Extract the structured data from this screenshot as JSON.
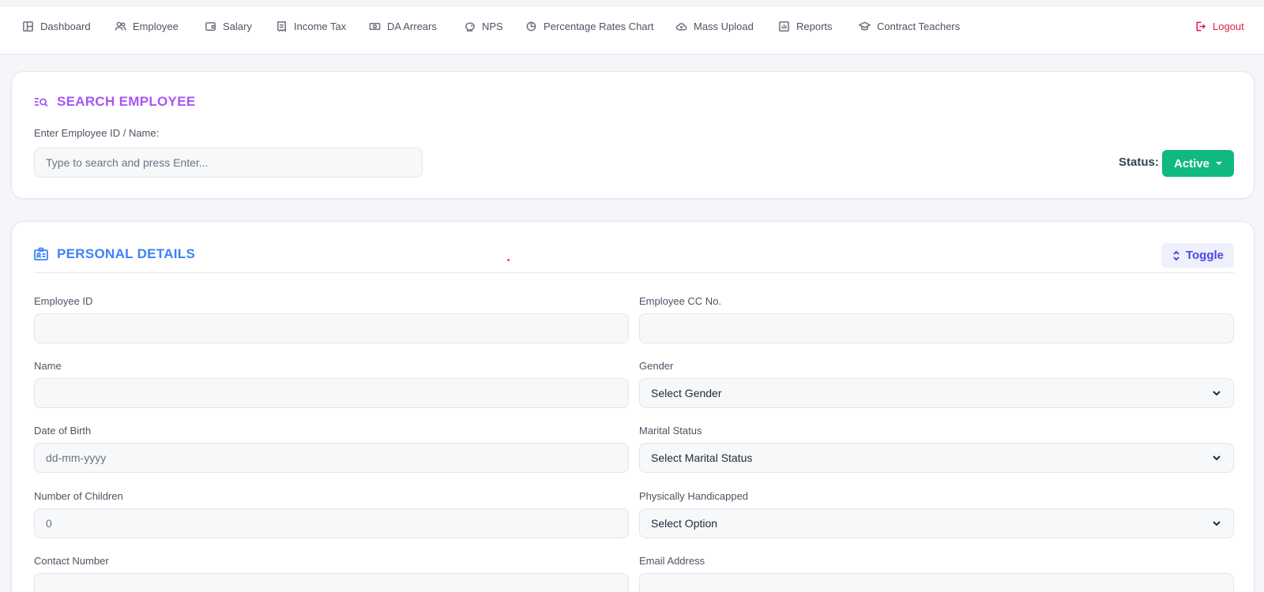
{
  "nav": {
    "items": [
      {
        "label": "Dashboard",
        "icon": "dashboard-icon"
      },
      {
        "label": "Employee",
        "icon": "users-icon"
      },
      {
        "label": "Salary",
        "icon": "wallet-icon"
      },
      {
        "label": "Income Tax",
        "icon": "receipt-icon"
      },
      {
        "label": "DA Arrears",
        "icon": "money-icon"
      },
      {
        "label": "NPS",
        "icon": "piggy-bank-icon"
      },
      {
        "label": "Percentage Rates Chart",
        "icon": "pie-chart-icon"
      },
      {
        "label": "Mass Upload",
        "icon": "cloud-upload-icon"
      },
      {
        "label": "Reports",
        "icon": "report-icon"
      },
      {
        "label": "Contract Teachers",
        "icon": "graduation-cap-icon"
      }
    ],
    "logout_label": "Logout"
  },
  "search": {
    "title": "SEARCH EMPLOYEE",
    "field_label": "Enter Employee ID / Name:",
    "placeholder": "Type to search and press Enter...",
    "status_label": "Status:",
    "status_value": "Active"
  },
  "personal": {
    "title": "PERSONAL DETAILS",
    "toggle_label": "Toggle",
    "fields": {
      "employee_id": {
        "label": "Employee ID",
        "value": ""
      },
      "employee_cc": {
        "label": "Employee CC No.",
        "value": ""
      },
      "name": {
        "label": "Name",
        "value": ""
      },
      "gender": {
        "label": "Gender",
        "value": "Select Gender"
      },
      "dob": {
        "label": "Date of Birth",
        "value": "dd-mm-yyyy"
      },
      "marital": {
        "label": "Marital Status",
        "value": "Select Marital Status"
      },
      "children": {
        "label": "Number of Children",
        "value": "0"
      },
      "handicapped": {
        "label": "Physically Handicapped",
        "value": "Select Option"
      },
      "contact": {
        "label": "Contact Number",
        "value": ""
      },
      "email": {
        "label": "Email Address",
        "value": ""
      }
    }
  },
  "colors": {
    "accent_purple": "#a855f7",
    "accent_blue": "#3b82f6",
    "status_green": "#10b981",
    "logout_red": "#e11d48"
  }
}
